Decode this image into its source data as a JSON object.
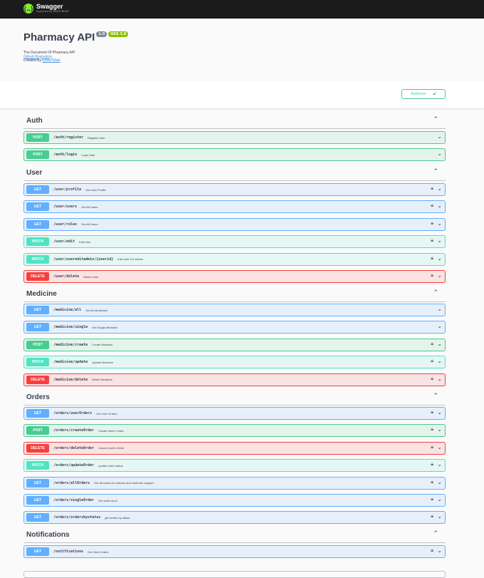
{
  "topbar": {
    "logo_text": "Swagger",
    "logo_sub": "Supported by SMARTBEAR",
    "logo_icon": "swagger-logo-icon"
  },
  "info": {
    "title": "Pharmacy API",
    "version_badge": "1.0",
    "oas_badge": "OAS 3.0",
    "description": "The Document Of Pharmacy API",
    "github_link": "Github Repository",
    "created_by_prefix": "Created By",
    "created_by_name": "Ezzat Wael"
  },
  "authorize": {
    "label": "Authorize",
    "icon": "lock-icon"
  },
  "tags": [
    {
      "name": "Auth",
      "operations": [
        {
          "method": "POST",
          "path": "/auth/register",
          "summary": "Register User",
          "locked": false
        },
        {
          "method": "POST",
          "path": "/auth/login",
          "summary": "Login User",
          "locked": false
        }
      ]
    },
    {
      "name": "User",
      "operations": [
        {
          "method": "GET",
          "path": "/user/profile",
          "summary": "Get User Profile",
          "locked": true
        },
        {
          "method": "GET",
          "path": "/user/users",
          "summary": "Get All Users",
          "locked": true
        },
        {
          "method": "GET",
          "path": "/user/roles",
          "summary": "Get All Users",
          "locked": true
        },
        {
          "method": "PATCH",
          "path": "/user/edit",
          "summary": "Edit User",
          "locked": true
        },
        {
          "method": "PATCH",
          "path": "/user/usereditadmin/{userid}",
          "summary": "Edit User For Admin",
          "locked": true
        },
        {
          "method": "DELETE",
          "path": "/user/delete",
          "summary": "Delete User",
          "locked": true
        }
      ]
    },
    {
      "name": "Medicine",
      "operations": [
        {
          "method": "GET",
          "path": "/medicine/all",
          "summary": "Get All Medicines",
          "locked": false
        },
        {
          "method": "GET",
          "path": "/medicine/single",
          "summary": "Get Single Medicine",
          "locked": false
        },
        {
          "method": "POST",
          "path": "/medicine/create",
          "summary": "Create Medicine",
          "locked": true
        },
        {
          "method": "PATCH",
          "path": "/medicine/update",
          "summary": "Update Medicine",
          "locked": true
        },
        {
          "method": "DELETE",
          "path": "/medicine/delete",
          "summary": "Delete Medicine",
          "locked": true
        }
      ]
    },
    {
      "name": "Orders",
      "operations": [
        {
          "method": "GET",
          "path": "/orders/userOrders",
          "summary": "Get User Orders",
          "locked": true
        },
        {
          "method": "POST",
          "path": "/orders/createOrder",
          "summary": "Create User's Order",
          "locked": true
        },
        {
          "method": "DELETE",
          "path": "/orders/deleteOrder",
          "summary": "Cancel User's Order",
          "locked": true
        },
        {
          "method": "PATCH",
          "path": "/orders/updateOrder",
          "summary": "update order status",
          "locked": true
        },
        {
          "method": "GET",
          "path": "/orders/allOrders",
          "summary": "Get all orders for admins and customer support",
          "locked": true
        },
        {
          "method": "GET",
          "path": "/orders/singleOrder",
          "summary": "Get order by id",
          "locked": true
        },
        {
          "method": "GET",
          "path": "/orders/ordersbystatus",
          "summary": "get orders by status",
          "locked": true
        }
      ]
    },
    {
      "name": "Notifications",
      "operations": [
        {
          "method": "GET",
          "path": "/notifications",
          "summary": "Get User Orders",
          "locked": true
        }
      ]
    }
  ],
  "colors": {
    "get": "#61affe",
    "post": "#49cc90",
    "patch": "#50e3c2",
    "delete": "#f93e3e",
    "topbar": "#1b1b1b"
  }
}
